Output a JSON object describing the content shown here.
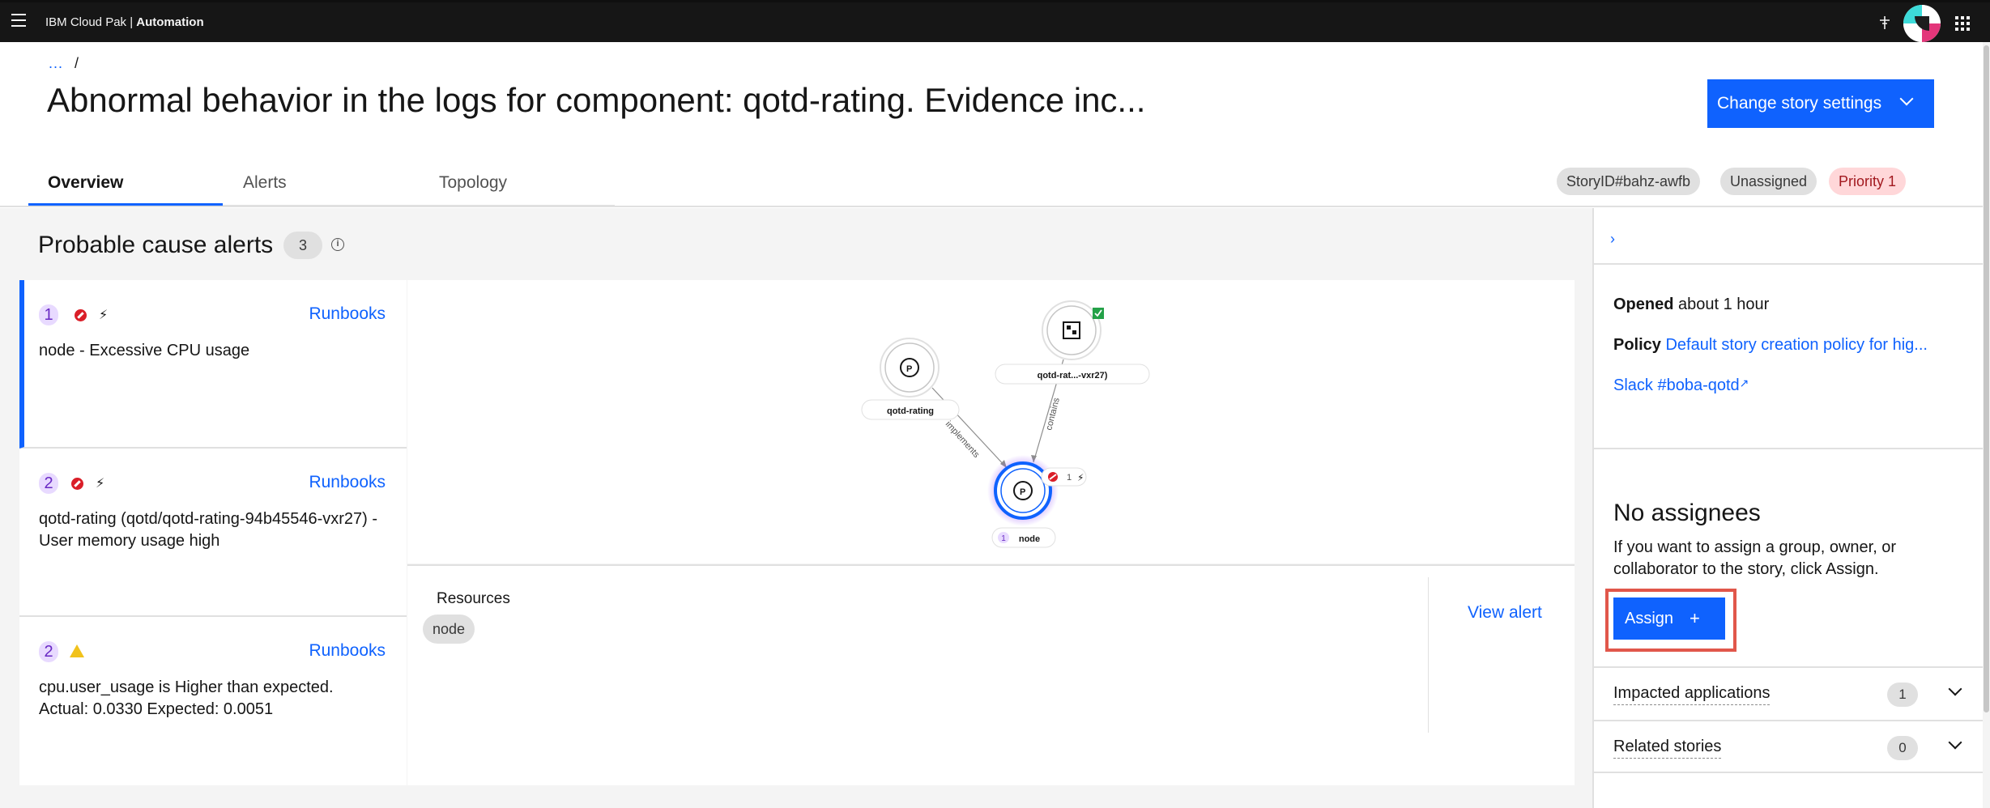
{
  "header": {
    "brand_prefix": "IBM Cloud Pak | ",
    "brand_product": "Automation",
    "icons": [
      "menu-icon",
      "pin-icon",
      "avatar",
      "app-switcher-icon"
    ]
  },
  "breadcrumb": {
    "ellipsis": "...",
    "separator": "/"
  },
  "page": {
    "title": "Abnormal behavior in the logs for component: qotd-rating. Evidence inc...",
    "change_settings_label": "Change story settings"
  },
  "tabs": [
    {
      "label": "Overview",
      "active": true
    },
    {
      "label": "Alerts",
      "active": false
    },
    {
      "label": "Topology",
      "active": false
    }
  ],
  "tags": {
    "story_id": "StoryID#bahz-awfb",
    "assignment": "Unassigned",
    "priority": "Priority 1"
  },
  "alerts_section": {
    "title": "Probable cause alerts",
    "count": "3",
    "items": [
      {
        "rank": "1",
        "severity": "critical",
        "runbooks_label": "Runbooks",
        "text": "node - Excessive CPU usage"
      },
      {
        "rank": "2",
        "severity": "critical",
        "runbooks_label": "Runbooks",
        "text": "qotd-rating (qotd/qotd-rating-94b45546-vxr27) - User memory usage high"
      },
      {
        "rank": "2",
        "severity": "warning",
        "runbooks_label": "Runbooks",
        "text": "cpu.user_usage is Higher than expected. Actual: 0.0330 Expected: 0.0051"
      }
    ]
  },
  "topology": {
    "nodes": [
      {
        "label": "qotd-rating"
      },
      {
        "label": "qotd-rat...-vxr27)"
      },
      {
        "label": "node",
        "rank": "1",
        "alert_count": "1"
      }
    ],
    "edges": [
      {
        "label": "implements"
      },
      {
        "label": "contains"
      }
    ]
  },
  "detail": {
    "resources_label": "Resources",
    "resource_chip": "node",
    "view_alert_label": "View alert"
  },
  "sidebar": {
    "opened_label": "Opened",
    "opened_value": "about 1 hour",
    "policy_label": "Policy",
    "policy_value": "Default story creation policy for hig...",
    "slack_link": "Slack #boba-qotd",
    "no_assignees_title": "No assignees",
    "assign_description": "If you want to assign a group, owner, or collaborator to the story, click Assign.",
    "assign_label": "Assign",
    "assign_plus": "+",
    "impacted_label": "Impacted applications",
    "impacted_count": "1",
    "related_label": "Related stories",
    "related_count": "0"
  },
  "colors": {
    "accent": "#0f62fe",
    "header_bg": "#161616",
    "critical": "#da1e28",
    "warning": "#f1c21b",
    "highlight_frame": "#e1574b"
  }
}
